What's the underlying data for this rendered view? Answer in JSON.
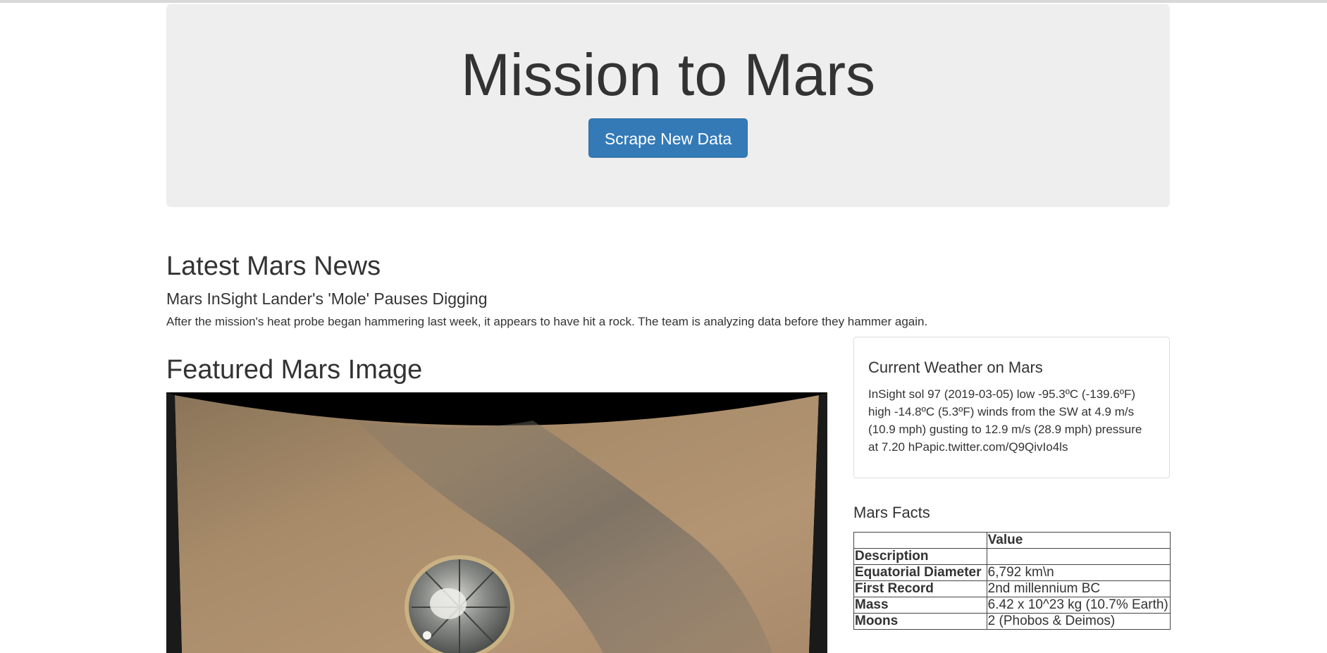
{
  "header": {
    "title": "Mission to Mars",
    "scrape_button": "Scrape New Data"
  },
  "news": {
    "section_title": "Latest Mars News",
    "headline": "Mars InSight Lander's 'Mole' Pauses Digging",
    "teaser": "After the mission's heat probe began hammering last week, it appears to have hit a rock. The team is analyzing data before they hammer again."
  },
  "featured": {
    "section_title": "Featured Mars Image"
  },
  "weather": {
    "title": "Current Weather on Mars",
    "text": "InSight sol 97 (2019-03-05) low -95.3ºC (-139.6ºF) high -14.8ºC (5.3ºF) winds from the SW at 4.9 m/s (10.9 mph) gusting to 12.9 m/s (28.9 mph) pressure at 7.20 hPapic.twitter.com/Q9QivIo4ls"
  },
  "facts": {
    "title": "Mars Facts",
    "header_value": "Value",
    "header_description": "Description",
    "rows": [
      {
        "label": "Equatorial Diameter",
        "value": "6,792 km\\n"
      },
      {
        "label": "First Record",
        "value": "2nd millennium BC"
      },
      {
        "label": "Mass",
        "value": "6.42 x 10^23 kg (10.7% Earth)"
      },
      {
        "label": "Moons",
        "value": "2 (Phobos & Deimos)"
      }
    ]
  },
  "colors": {
    "button": "#337ab7",
    "jumbotron": "#eeeeee",
    "text": "#333333"
  }
}
